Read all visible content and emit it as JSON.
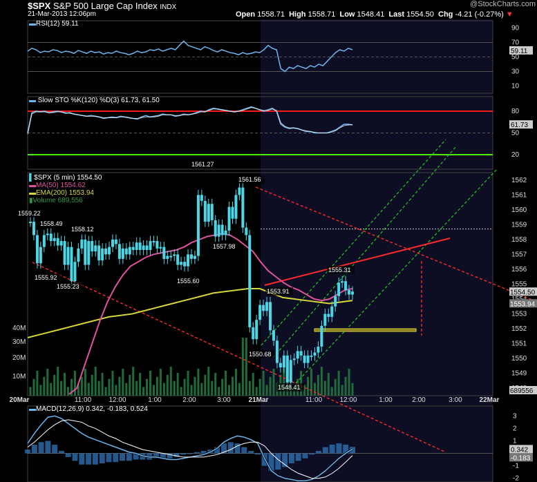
{
  "header": {
    "symbol": "$SPX",
    "name": "S&P 500 Large Cap Index",
    "exchange": "INDX",
    "datetime": "21-Mar-2013 12:06pm",
    "watermark": "@StockCharts.com",
    "open_label": "Open",
    "open": "1558.71",
    "high_label": "High",
    "high": "1558.71",
    "low_label": "Low",
    "low": "1548.41",
    "last_label": "Last",
    "last": "1554.50",
    "chg_label": "Chg",
    "chg": "-4.21 (-0.27%)"
  },
  "colors": {
    "background": "#000000",
    "session_shade": "#0d0d24",
    "price": "#4fd6e6",
    "ma50": "#e0539e",
    "ema200": "#d8d83a",
    "volume": "#1f6b3a",
    "indicator_line": "#6fb6ee",
    "trend_red": "#ff2a2a",
    "channel_green": "#1fbf1f",
    "overbought": "#ff1a1a",
    "oversold": "#44ee00"
  },
  "chart_data": [
    {
      "type": "line",
      "title": "RSI(12) 59.11",
      "ylim": [
        0,
        100
      ],
      "ticks": [
        "90",
        "70",
        "50",
        "30",
        "10"
      ],
      "current_label": "59.11",
      "series": [
        {
          "name": "RSI(12)",
          "values": [
            58,
            62,
            60,
            56,
            58,
            57,
            60,
            59,
            56,
            58,
            57,
            55,
            59,
            57,
            55,
            58,
            56,
            57,
            54,
            56,
            55,
            58,
            56,
            55,
            53,
            55,
            58,
            56,
            57,
            60,
            59,
            61,
            58,
            60,
            62,
            60,
            66,
            72,
            66,
            64,
            62,
            60,
            64,
            62,
            59,
            57,
            60,
            58,
            56,
            55,
            53,
            56,
            54,
            55,
            57,
            56,
            60,
            66,
            62,
            60,
            34,
            30,
            36,
            34,
            38,
            36,
            34,
            38,
            36,
            40,
            38,
            44,
            50,
            56,
            60,
            58,
            62,
            60
          ]
        }
      ]
    },
    {
      "type": "line",
      "title": "Slow STO %K(120) %D(3) 61.73, 61.50",
      "ylim": [
        0,
        100
      ],
      "ticks": [
        "80",
        "50",
        "20"
      ],
      "current_label": "61.73",
      "series": [
        {
          "name": "%K(120)",
          "values": [
            50,
            78,
            80,
            79,
            80,
            78,
            79,
            80,
            79,
            77,
            78,
            76,
            75,
            74,
            73,
            74,
            73,
            72,
            70,
            71,
            72,
            71,
            73,
            72,
            71,
            70,
            69,
            72,
            74,
            72,
            73,
            74,
            76,
            75,
            75,
            73,
            74,
            76,
            75,
            76,
            78,
            80,
            79,
            82,
            84,
            83,
            82,
            81,
            80,
            79,
            80,
            82,
            84,
            86,
            84,
            82,
            80,
            82,
            84,
            80,
            62,
            58,
            56,
            57,
            56,
            54,
            52,
            52,
            50,
            50,
            50,
            50,
            52,
            54,
            58,
            62,
            62,
            61
          ]
        },
        {
          "name": "%D(3)",
          "values": [
            48,
            76,
            79,
            79,
            79,
            78,
            78,
            79,
            79,
            78,
            77,
            76,
            75,
            74,
            73,
            73,
            73,
            72,
            71,
            71,
            71,
            71,
            72,
            72,
            71,
            70,
            70,
            71,
            72,
            72,
            72,
            73,
            75,
            75,
            75,
            74,
            74,
            75,
            75,
            76,
            77,
            79,
            79,
            81,
            83,
            83,
            82,
            81,
            80,
            79,
            80,
            81,
            83,
            85,
            84,
            82,
            81,
            81,
            83,
            81,
            64,
            59,
            57,
            57,
            56,
            54,
            53,
            52,
            51,
            50,
            50,
            50,
            51,
            53,
            57,
            60,
            61,
            61.5
          ]
        }
      ]
    },
    {
      "type": "line",
      "title": "$SPX (5 min) 1554.50",
      "ylim": [
        1547.5,
        1562.5
      ],
      "ticks": [
        "1562",
        "1561",
        "1560",
        "1559",
        "1558",
        "1557",
        "1556",
        "1555",
        "1554",
        "1553",
        "1552",
        "1551",
        "1550",
        "1549",
        "1548"
      ],
      "current_label": "1554.50",
      "ema_label": "1553.94",
      "xlabels": [
        "20Mar",
        "11:00",
        "12:00",
        "1:00",
        "2:00",
        "3:00",
        "21Mar",
        "11:00",
        "12:00",
        "1:00",
        "2:00",
        "3:00",
        "22Mar"
      ],
      "volume_ticks": [
        "40M",
        "30M",
        "20M",
        "10M"
      ],
      "volume_current": "689556",
      "legend": [
        "$SPX (5 min) 1554.50",
        "MA(50) 1554.62",
        "EMA(200) 1553.94",
        "Volume 689,556"
      ],
      "annotations": [
        "1559.22",
        "1558.49",
        "1558.12",
        "1555.92",
        "1555.23",
        "1561.27",
        "1561.56",
        "1557.98",
        "1555.60",
        "1553.91",
        "1550.68",
        "1548.41",
        "1555.31"
      ],
      "series": [
        {
          "name": "$SPX (5 min)",
          "values": [
            1559.2,
            1558.3,
            1556.4,
            1557.5,
            1558.3,
            1558.4,
            1557.9,
            1558.1,
            1557.6,
            1557.9,
            1556.3,
            1557.5,
            1555.2,
            1556.5,
            1557.4,
            1558.0,
            1556.3,
            1557.9,
            1557.2,
            1557.6,
            1556.6,
            1557.4,
            1557.0,
            1557.5,
            1558.0,
            1557.7,
            1556.7,
            1557.4,
            1557.0,
            1557.5,
            1557.3,
            1557.8,
            1557.3,
            1557.6,
            1557.3,
            1557.9,
            1557.9,
            1557.4,
            1557.5,
            1556.7,
            1556.9,
            1556.9,
            1557.0,
            1556.3,
            1556.5,
            1556.2,
            1557.0,
            1556.7,
            1556.9,
            1561.0,
            1560.6,
            1559.2,
            1560.4,
            1559.3,
            1558.2,
            1559.0,
            1558.3,
            1558.6,
            1560.2,
            1559.4,
            1561.0,
            1561.5,
            1558.8,
            1558.3,
            1552.1,
            1551.3,
            1552.6,
            1553.6,
            1553.2,
            1553.8,
            1551.9,
            1551.2,
            1549.7,
            1549.4,
            1550.2,
            1548.4,
            1549.9,
            1550.0,
            1550.5,
            1550.2,
            1549.7,
            1550.2,
            1550.2,
            1550.4,
            1550.8,
            1552.2,
            1553.0,
            1552.8,
            1553.5,
            1554.2,
            1555.1,
            1555.2,
            1554.6,
            1554.3,
            1554.5
          ]
        },
        {
          "name": "MA(50)",
          "values": [
            1547.6,
            1548.0,
            1549.5,
            1551.0,
            1552.5,
            1553.8,
            1554.8,
            1555.6,
            1556.2,
            1556.5,
            1556.8,
            1557.0,
            1557.1,
            1557.2,
            1557.3,
            1557.5,
            1557.8,
            1558.0,
            1558.2,
            1558.3,
            1558.4,
            1558.3,
            1558.0,
            1557.6,
            1557.2,
            1556.5,
            1555.9,
            1555.5,
            1555.1,
            1554.8,
            1554.6,
            1554.3,
            1554.0,
            1553.9,
            1554.0,
            1554.3,
            1554.6,
            1554.7
          ]
        },
        {
          "name": "EMA(200)",
          "values": [
            1551.4,
            1551.6,
            1551.8,
            1552.0,
            1552.2,
            1552.4,
            1552.6,
            1552.8,
            1552.9,
            1553.0,
            1553.2,
            1553.4,
            1553.6,
            1553.8,
            1554.0,
            1554.2,
            1554.4,
            1554.5,
            1554.6,
            1554.7,
            1554.7,
            1554.4,
            1554.1,
            1554.0,
            1553.9,
            1553.8,
            1553.7,
            1553.8,
            1553.9
          ]
        }
      ]
    },
    {
      "type": "area",
      "title": "MACD(12,26,9) 0.342, -0.183, 0.524",
      "ylim": [
        -2.3,
        3.8
      ],
      "ticks": [
        "3",
        "2",
        "1",
        "0",
        "-1",
        "-2"
      ],
      "macd_label": "0.342",
      "signal_label": "-0.183",
      "series": [
        {
          "name": "MACD",
          "values": [
            0.8,
            1.6,
            2.3,
            2.9,
            3.0,
            2.8,
            2.4,
            2.0,
            1.6,
            1.3,
            1.1,
            0.9,
            0.7,
            0.5,
            0.3,
            0.1,
            0,
            -0.2,
            -0.3,
            -0.3,
            -0.4,
            -0.5,
            -0.5,
            -0.4,
            -0.3,
            -0.2,
            -0.1,
            0.1,
            0.4,
            0.9,
            1.2,
            1.4,
            1.3,
            1.1,
            0.8,
            -0.4,
            -1.4,
            -1.8,
            -2.0,
            -2.1,
            -2.2,
            -2.2,
            -2.1,
            -1.8,
            -1.4,
            -0.9,
            -0.4,
            0,
            0.34
          ]
        },
        {
          "name": "Signal",
          "values": [
            0.5,
            0.9,
            1.4,
            1.9,
            2.3,
            2.6,
            2.7,
            2.6,
            2.5,
            2.2,
            2.0,
            1.7,
            1.4,
            1.2,
            0.9,
            0.7,
            0.5,
            0.3,
            0.2,
            0.1,
            0,
            -0.1,
            -0.2,
            -0.3,
            -0.3,
            -0.3,
            -0.3,
            -0.2,
            -0.1,
            0.1,
            0.3,
            0.6,
            0.8,
            0.9,
            0.9,
            0.6,
            0,
            -0.5,
            -0.9,
            -1.3,
            -1.6,
            -1.8,
            -2.0,
            -2.0,
            -1.9,
            -1.6,
            -1.2,
            -0.7,
            -0.18
          ]
        }
      ]
    }
  ]
}
